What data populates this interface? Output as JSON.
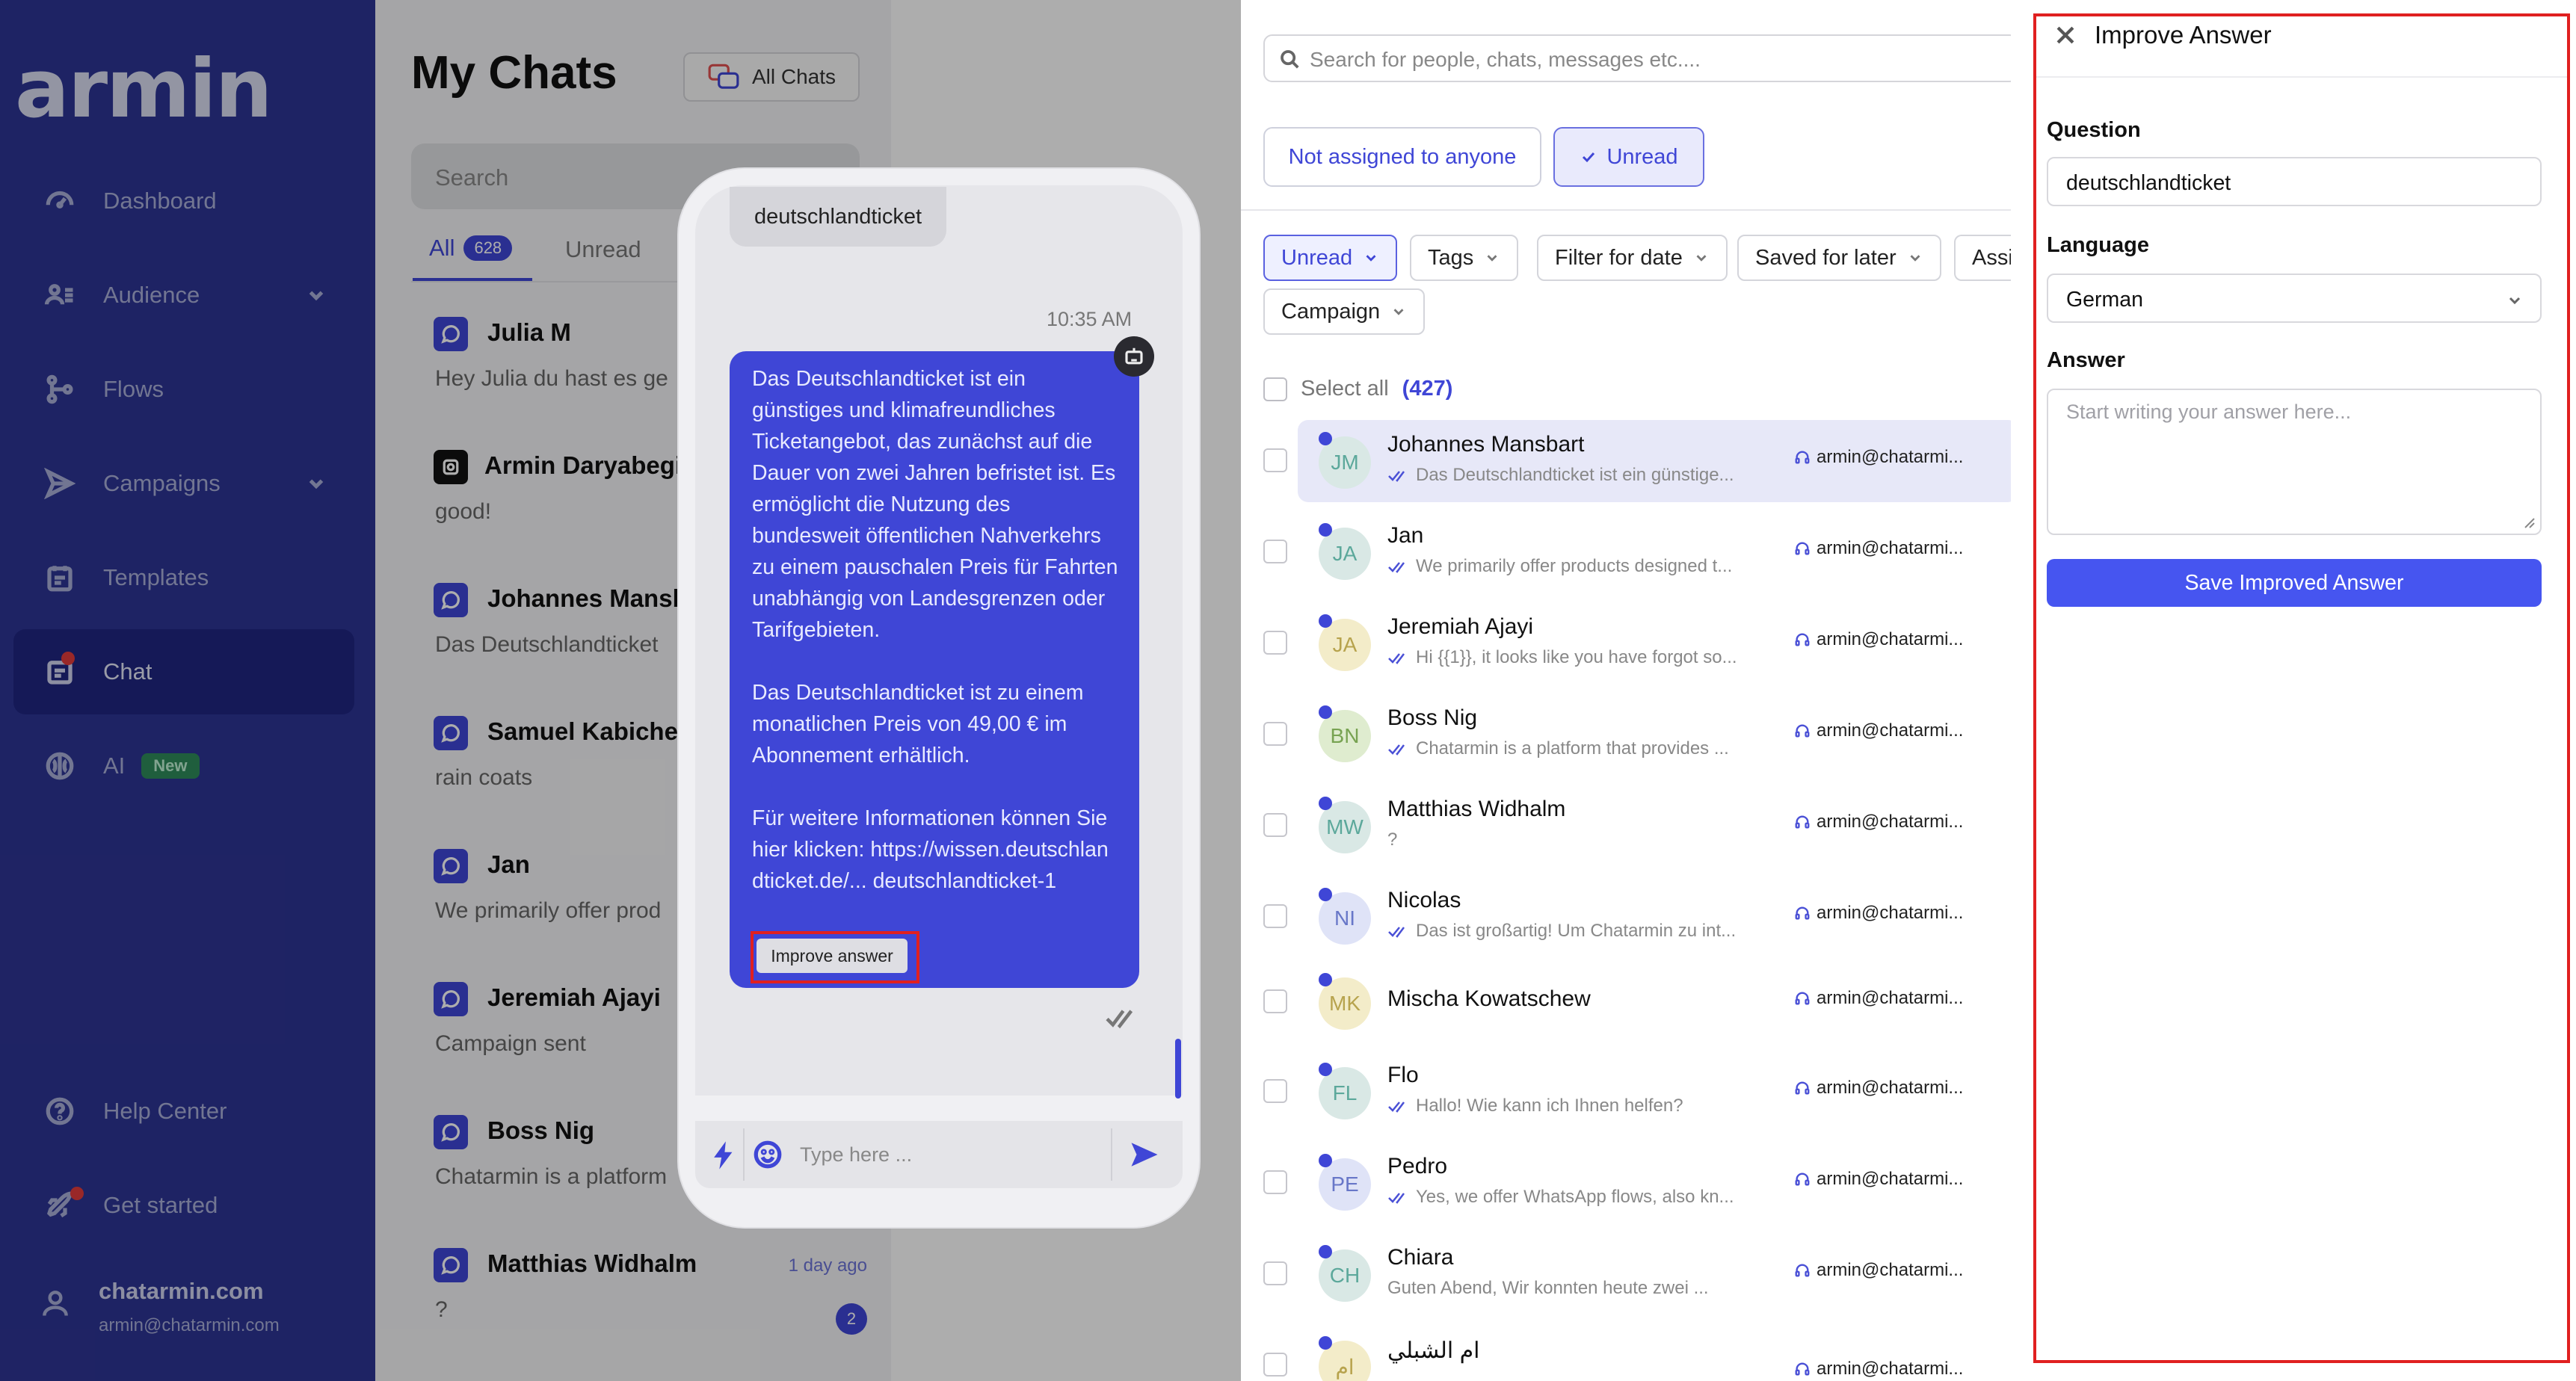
{
  "sidebar": {
    "logo": "armin",
    "items": [
      {
        "label": "Dashboard",
        "icon": "gauge-icon"
      },
      {
        "label": "Audience",
        "icon": "users-icon"
      },
      {
        "label": "Flows",
        "icon": "flow-icon"
      },
      {
        "label": "Campaigns",
        "icon": "send-icon"
      },
      {
        "label": "Templates",
        "icon": "template-icon"
      },
      {
        "label": "Chat",
        "icon": "chat-icon",
        "active": true
      },
      {
        "label": "AI",
        "icon": "ai-icon",
        "badge": "New"
      }
    ],
    "bottom": [
      {
        "label": "Help Center",
        "icon": "help-icon"
      },
      {
        "label": "Get started",
        "icon": "rocket-icon"
      }
    ],
    "account": {
      "name": "chatarmin.com",
      "email": "armin@chatarmin.com"
    }
  },
  "chatlist": {
    "title": "My Chats",
    "filter_button": "All Chats",
    "search_placeholder": "Search",
    "tabs": {
      "all": "All",
      "all_count": "628",
      "unread": "Unread"
    },
    "items": [
      {
        "name": "Julia M",
        "preview": "Hey Julia du hast es ge"
      },
      {
        "name": "Armin Daryabegi",
        "preview": "good!"
      },
      {
        "name": "Johannes Mansb",
        "preview": "Das Deutschlandticket"
      },
      {
        "name": "Samuel Kabiche",
        "preview": "rain coats"
      },
      {
        "name": "Jan",
        "preview": "We primarily offer prod"
      },
      {
        "name": "Jeremiah Ajayi",
        "preview": "Campaign sent"
      },
      {
        "name": "Boss Nig",
        "preview": "Chatarmin is a platform"
      },
      {
        "name": "Matthias Widhalm",
        "preview": "?",
        "time": "1 day ago",
        "badge": "2"
      }
    ]
  },
  "inbox": {
    "search_placeholder": "Search for people, chats, messages etc....",
    "quick_filters": [
      "Not assigned to anyone",
      "Unread"
    ],
    "filters": [
      "Unread",
      "Tags",
      "Filter for date",
      "Saved for later",
      "Assi",
      "Campaign"
    ],
    "select_all": "Select all",
    "select_count": "(427)",
    "rows": [
      {
        "initials": "JM",
        "name": "Johannes Mansbart",
        "preview": "Das Deutschlandticket ist ein günstige...",
        "assignee": "armin@chatarmi..."
      },
      {
        "initials": "JA",
        "name": "Jan",
        "preview": "We primarily offer products designed t...",
        "assignee": "armin@chatarmi..."
      },
      {
        "initials": "JA",
        "name": "Jeremiah Ajayi",
        "preview": "Hi {{1}}, it looks like you have forgot so...",
        "assignee": "armin@chatarmi..."
      },
      {
        "initials": "BN",
        "name": "Boss Nig",
        "preview": "Chatarmin is a platform that provides ...",
        "assignee": "armin@chatarmi..."
      },
      {
        "initials": "MW",
        "name": "Matthias Widhalm",
        "preview": "?",
        "assignee": "armin@chatarmi..."
      },
      {
        "initials": "NI",
        "name": "Nicolas",
        "preview": "Das ist großartig! Um Chatarmin zu int...",
        "assignee": "armin@chatarmi..."
      },
      {
        "initials": "MK",
        "name": "Mischa Kowatschew",
        "preview": "",
        "assignee": "armin@chatarmi..."
      },
      {
        "initials": "FL",
        "name": "Flo",
        "preview": "Hallo! Wie kann ich Ihnen helfen?",
        "assignee": "armin@chatarmi..."
      },
      {
        "initials": "PE",
        "name": "Pedro",
        "preview": "Yes, we offer WhatsApp flows, also kn...",
        "assignee": "armin@chatarmi..."
      },
      {
        "initials": "CH",
        "name": "Chiara",
        "preview": "Guten Abend, Wir konnten heute zwei ...",
        "assignee": "armin@chatarmi..."
      },
      {
        "initials": "ام",
        "name": "ام الشبلي",
        "preview": "",
        "assignee": "armin@chatarmi..."
      }
    ]
  },
  "phone": {
    "question": "deutschlandticket",
    "time": "10:35 AM",
    "answer_paragraphs": [
      "Das Deutschlandticket ist ein günstiges und klimafreundliches Ticketangebot, das zunächst auf die Dauer von zwei Jahren befristet ist. Es ermöglicht die Nutzung des bundesweit öffentlichen Nahverkehrs zu einem pauschalen Preis für Fahrten unabhängig von Landesgrenzen oder Tarifgebieten.",
      "Das Deutschlandticket ist zu einem monatlichen Preis von 49,00 € im Abonnement erhältlich.",
      "Für weitere Informationen können Sie hier klicken: https://wissen.deutschlandticket.de/... deutschlandticket-1"
    ],
    "improve_button": "Improve answer",
    "composer_placeholder": "Type here ..."
  },
  "improve_panel": {
    "title": "Improve Answer",
    "question_label": "Question",
    "question_value": "deutschlandticket",
    "language_label": "Language",
    "language_value": "German",
    "answer_label": "Answer",
    "answer_placeholder": "Start writing your answer here...",
    "save_button": "Save Improved Answer"
  },
  "colors": {
    "primary": "#3f46d6",
    "sidebar": "#2d3494",
    "highlight": "#e02020",
    "save": "#4655f0"
  }
}
